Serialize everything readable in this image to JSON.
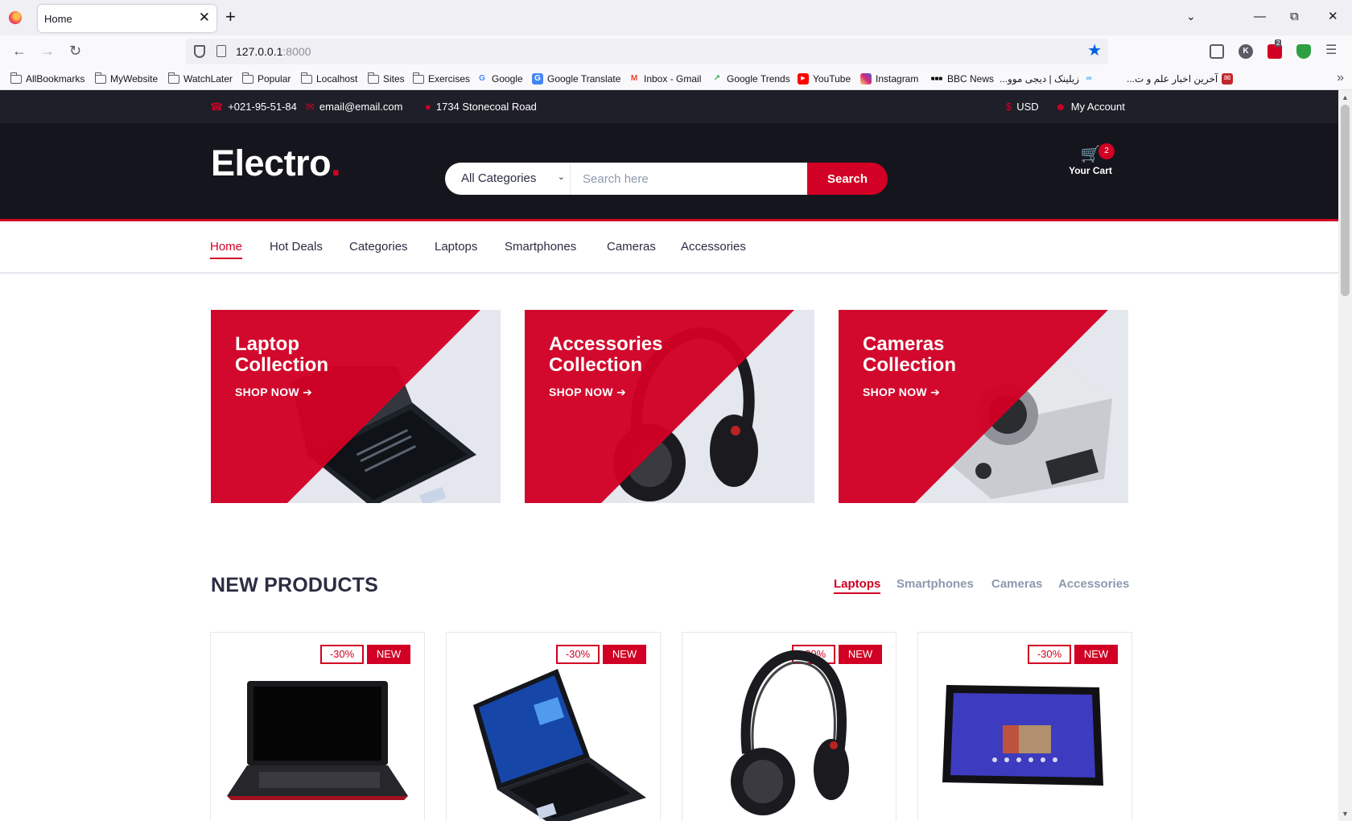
{
  "browser": {
    "tab_title": "Home",
    "tab_close": "✕",
    "new_tab": "+",
    "url_host": "127.0.0.1",
    "url_port": ":8000",
    "bookmarks": [
      {
        "label": "AllBookmarks",
        "icon": "folder-icon"
      },
      {
        "label": "MyWebsite",
        "icon": "folder-icon"
      },
      {
        "label": "WatchLater",
        "icon": "folder-icon"
      },
      {
        "label": "Popular",
        "icon": "folder-icon"
      },
      {
        "label": "Localhost",
        "icon": "folder-icon"
      },
      {
        "label": "Sites",
        "icon": "folder-icon"
      },
      {
        "label": "Exercises",
        "icon": "folder-icon"
      },
      {
        "label": "Google",
        "icon": "google-icon"
      },
      {
        "label": "Google Translate",
        "icon": "google-translate-icon"
      },
      {
        "label": "Inbox - Gmail",
        "icon": "gmail-icon"
      },
      {
        "label": "Google Trends",
        "icon": "google-trends-icon"
      },
      {
        "label": "YouTube",
        "icon": "youtube-icon"
      },
      {
        "label": "Instagram",
        "icon": "instagram-icon"
      },
      {
        "label": "BBC News",
        "icon": "bbc-icon"
      },
      {
        "label": "زیلینک | دیجی موو...",
        "icon": "zilink-icon"
      },
      {
        "label": "آخرین اخبار علم و ت...",
        "icon": "news-icon"
      }
    ],
    "extension_badge": "2"
  },
  "top_header": {
    "phone": "+021-95-51-84",
    "email": "email@email.com",
    "address": "1734 Stonecoal Road",
    "currency": "USD",
    "account": "My Account"
  },
  "header": {
    "logo_text": "Electro",
    "logo_dot": ".",
    "category_selected": "All Categories",
    "search_placeholder": "Search here",
    "search_button": "Search",
    "cart_label": "Your Cart",
    "cart_qty": "2"
  },
  "nav": {
    "items": [
      "Home",
      "Hot Deals",
      "Categories",
      "Laptops",
      "Smartphones",
      "Cameras",
      "Accessories"
    ],
    "active": "Home"
  },
  "collections": [
    {
      "title_line1": "Laptop",
      "title_line2": "Collection",
      "cta": "SHOP NOW ➔"
    },
    {
      "title_line1": "Accessories",
      "title_line2": "Collection",
      "cta": "SHOP NOW ➔"
    },
    {
      "title_line1": "Cameras",
      "title_line2": "Collection",
      "cta": "SHOP NOW ➔"
    }
  ],
  "new_products": {
    "title": "NEW PRODUCTS",
    "tabs": [
      "Laptops",
      "Smartphones",
      "Cameras",
      "Accessories"
    ],
    "active_tab": "Laptops",
    "products": [
      {
        "sale": "-30%",
        "new": "NEW",
        "image": "laptop-black-red"
      },
      {
        "sale": "-30%",
        "new": "NEW",
        "image": "laptop-asus-windows"
      },
      {
        "sale": "-30%",
        "new": "NEW",
        "image": "headphones"
      },
      {
        "sale": "-30%",
        "new": "NEW",
        "image": "tablet"
      }
    ]
  },
  "colors": {
    "accent": "#D10024",
    "dark_header": "#15161D",
    "top_header": "#1E1F29",
    "text": "#2B2D42",
    "muted": "#8D99AE"
  }
}
